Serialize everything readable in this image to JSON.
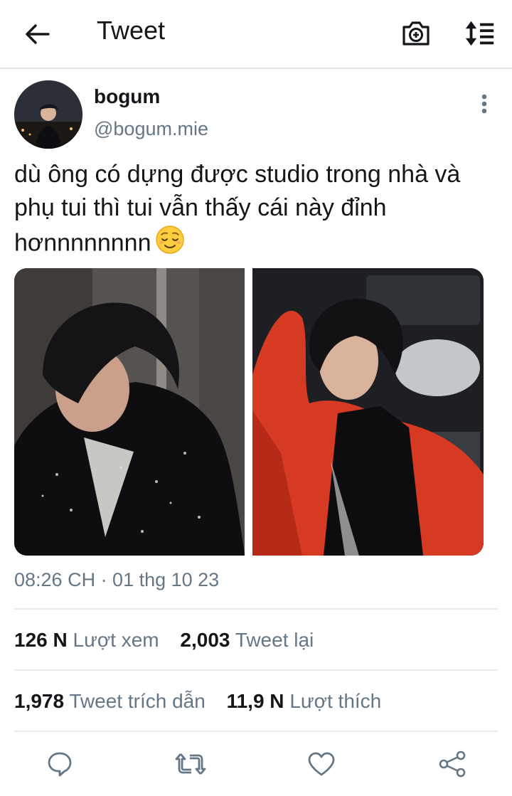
{
  "header": {
    "title": "Tweet",
    "icons": [
      "back-arrow-icon",
      "camera-add-icon",
      "sort-icon"
    ]
  },
  "tweet": {
    "author_name": "bogum",
    "author_handle": "@bogum.mie",
    "text": "dù ông có dựng được studio trong nhà và phụ tui thì tui vẫn thấy cái này đỉnh hơnnnnnnnn",
    "emoji": "relieved-face-emoji",
    "timestamp": "08:26 CH · 01 thg 10 23"
  },
  "stats": {
    "views_count": "126 N",
    "views_label": "Lượt xem",
    "retweets_count": "2,003",
    "retweets_label": "Tweet lại",
    "quotes_count": "1,978",
    "quotes_label": "Tweet trích dẫn",
    "likes_count": "11,9 N",
    "likes_label": "Lượt thích"
  },
  "actions": [
    "reply-icon",
    "retweet-icon",
    "like-icon",
    "share-icon"
  ],
  "colors": {
    "text": "#14171a",
    "secondary": "#657786",
    "divider": "#e6ecf0",
    "icon": "#657786",
    "jacket_red": "#d63a22"
  }
}
